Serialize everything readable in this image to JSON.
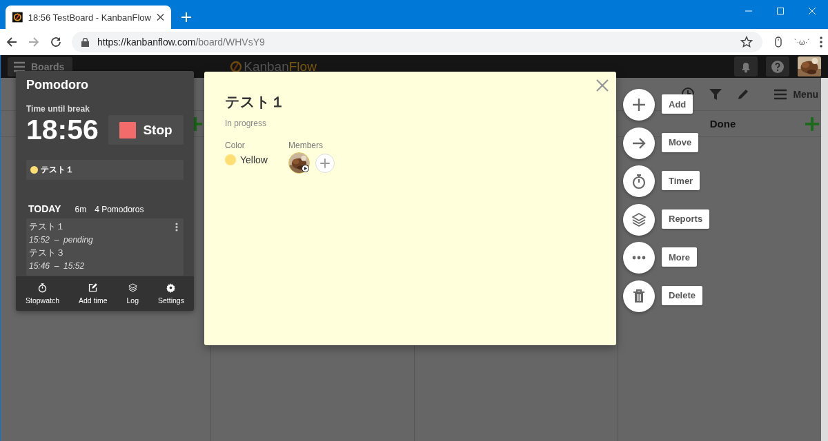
{
  "browser": {
    "tab_title": "18:56 TestBoard - KanbanFlow",
    "url_host": "https://kanbanflow.com",
    "url_path": "/board/WHVsY9",
    "extension_text": "`·ω·´"
  },
  "header": {
    "boards_label": "Boards",
    "logo_part_1": "Kanban",
    "logo_part_2": "Flow"
  },
  "toolbar": {
    "menu_label": "Menu"
  },
  "columns": [
    {
      "add_button": true
    },
    {},
    {},
    {
      "title": "Done",
      "add_button": true
    }
  ],
  "pomodoro": {
    "title": "Pomodoro",
    "subtitle": "Time until break",
    "time": "18:56",
    "stop_label": "Stop",
    "current_task": "テスト１",
    "today_label": "TODAY",
    "today_duration": "6m",
    "today_count": "4 Pomodoros",
    "log": [
      {
        "name": "テスト１",
        "time": "15:52  –  pending"
      },
      {
        "name": "テスト３",
        "time": "15:46  –  15:52"
      }
    ],
    "footer": [
      {
        "kind": "stopwatch",
        "label": "Stopwatch"
      },
      {
        "kind": "edit",
        "label": "Add time"
      },
      {
        "kind": "layers",
        "label": "Log"
      },
      {
        "kind": "gear",
        "label": "Settings"
      }
    ]
  },
  "task": {
    "title": "テスト１",
    "status": "In progress",
    "color_label": "Color",
    "color_name": "Yellow",
    "color": "#ffdf73",
    "members_label": "Members"
  },
  "actions": [
    {
      "kind": "add",
      "label": "Add"
    },
    {
      "kind": "move",
      "label": "Move"
    },
    {
      "kind": "timer",
      "label": "Timer"
    },
    {
      "kind": "layers",
      "label": "Reports"
    },
    {
      "kind": "more",
      "label": "More"
    },
    {
      "kind": "delete",
      "label": "Delete"
    }
  ]
}
